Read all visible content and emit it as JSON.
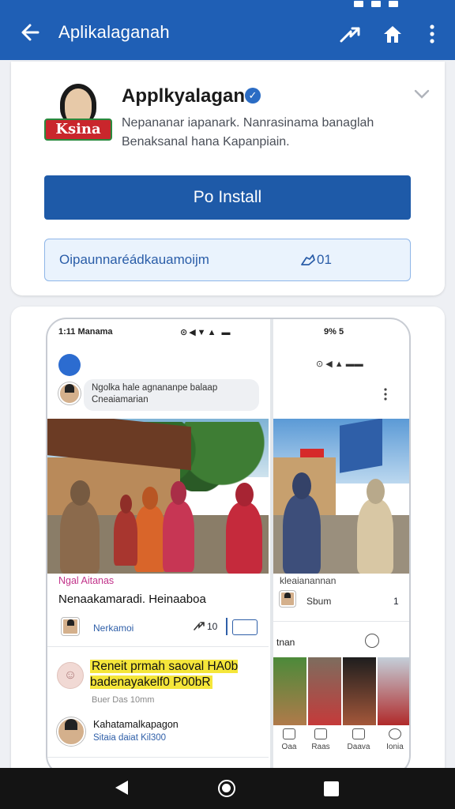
{
  "appbar": {
    "title": "Aplikalaganah"
  },
  "listing": {
    "logo_text": "Ksina",
    "app_name": "Applkyalagan",
    "description": "Nepananar iapanark. Nanrasinama banaglah Benaksanal hana Kapanpiain.",
    "install_label": "Po Install",
    "promo_text": "Oipaunnaréádkauamoijm",
    "promo_count": "01"
  },
  "screenshot": {
    "left": {
      "status_text": "1:11 Manama",
      "bubble_text": "Ngolka hale agnananpe balaap Cneaiamarian",
      "hashtag": "Ngal Aitanas",
      "headline": "Nenaakamaradi. Heinaaboa",
      "author": "Nerkamoi",
      "share_count": "10",
      "highlight": "Reneit prmah saoval HA0b badenayakelf0 P00bR",
      "highlight_meta": "Buer Das 10mm",
      "commenter_name": "Kahatamalkapagon",
      "commenter_sub": "Sitaia daiat Kil300"
    },
    "right": {
      "status_text": "9% 5",
      "hashtag": "kleaianannan",
      "author": "Sbum",
      "share_count": "1",
      "section": "tnan",
      "nav": [
        "Oaa",
        "Raas",
        "Daava",
        "Ionia"
      ]
    }
  }
}
